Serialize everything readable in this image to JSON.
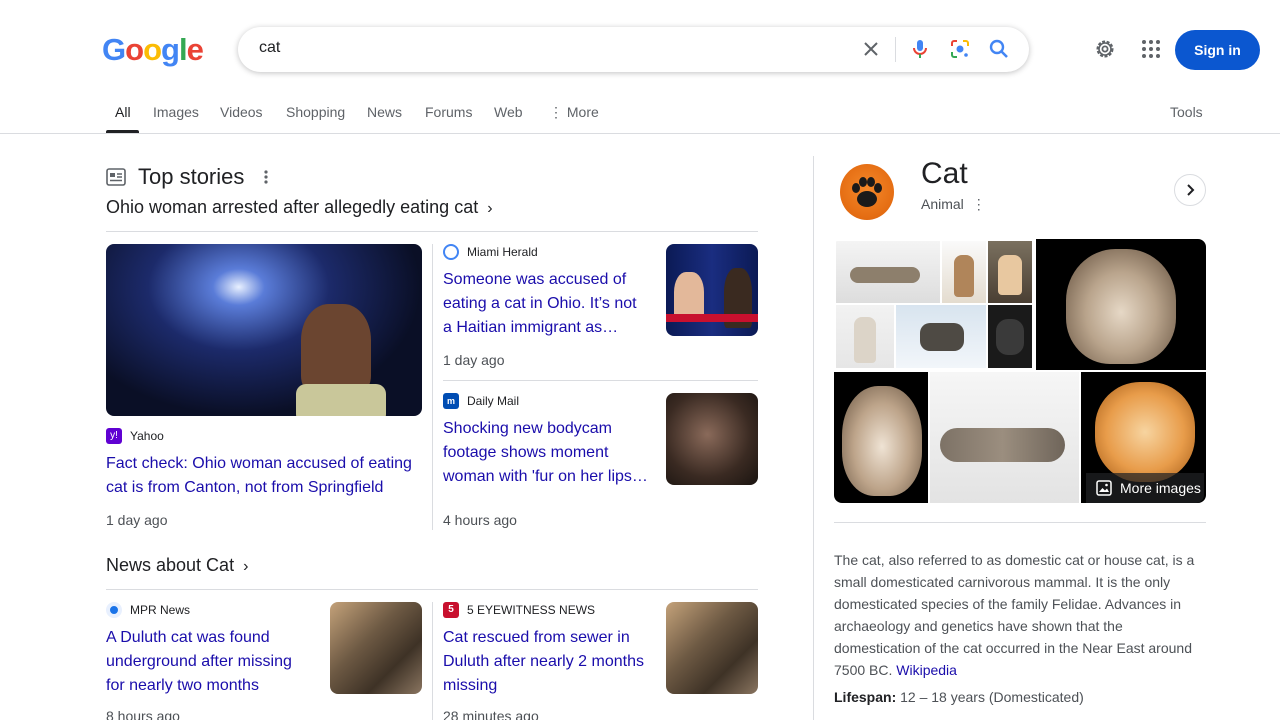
{
  "logo": {
    "letters": [
      "G",
      "o",
      "o",
      "g",
      "l",
      "e"
    ],
    "colors": [
      "#4285f4",
      "#ea4335",
      "#fbbc05",
      "#4285f4",
      "#34a853",
      "#ea4335"
    ]
  },
  "search": {
    "query": "cat"
  },
  "header": {
    "sign_in": "Sign in"
  },
  "tabs": [
    "All",
    "Images",
    "Videos",
    "Shopping",
    "News",
    "Forums",
    "Web",
    "More"
  ],
  "tools": "Tools",
  "top_stories": {
    "title": "Top stories",
    "headline": "Ohio woman arrested after allegedly eating cat",
    "stories": [
      {
        "source": "Yahoo",
        "title_l1": "Fact check: Ohio woman accused of eating",
        "title_l2": "cat is from Canton, not from Springfield",
        "time": "1 day ago"
      },
      {
        "source": "Miami Herald",
        "title_l1": "Someone was accused of",
        "title_l2": "eating a cat in Ohio. It’s not",
        "title_l3": "a Haitian immigrant as…",
        "time": "1 day ago"
      },
      {
        "source": "Daily Mail",
        "title_l1": "Shocking new bodycam",
        "title_l2": "footage shows moment",
        "title_l3": "woman with 'fur on her lips…",
        "time": "4 hours ago"
      }
    ]
  },
  "news_about": {
    "title": "News about Cat",
    "stories": [
      {
        "source": "MPR News",
        "title_l1": "A Duluth cat was found",
        "title_l2": "underground after missing",
        "title_l3": "for nearly two months",
        "time": "8 hours ago"
      },
      {
        "source": "5 EYEWITNESS NEWS",
        "title_l1": "Cat rescued from sewer in",
        "title_l2": "Duluth after nearly 2 months",
        "title_l3": "missing",
        "time": "28 minutes ago"
      }
    ]
  },
  "knowledge_panel": {
    "title": "Cat",
    "subtitle": "Animal",
    "more_images": "More images",
    "description": "The cat, also referred to as domestic cat or house cat, is a small domesticated carnivorous mammal. It is the only domesticated species of the family Felidae. Advances in archaeology and genetics have shown that the domestication of the cat occurred in the Near East around 7500 BC.",
    "wiki_link": "Wikipedia",
    "lifespan_label": "Lifespan:",
    "lifespan_value": "12 – 18 years (Domesticated)"
  }
}
